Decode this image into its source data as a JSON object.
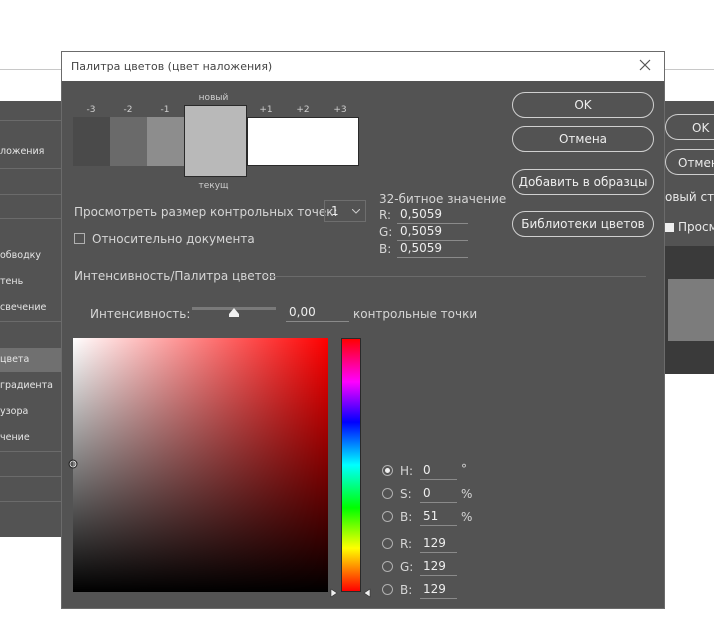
{
  "background_left_items": [
    "ложения",
    "обводку",
    "тень",
    "свечение",
    "цвета",
    "градиента",
    "узора",
    "чение"
  ],
  "background_right": {
    "ok": "OK",
    "cancel": "Отмен",
    "style": "овый сти",
    "preview": "Просм"
  },
  "dialog": {
    "title": "Палитра цветов (цвет наложения)",
    "swatch_labels": {
      "new": "новый",
      "current": "текущ"
    },
    "ticks": [
      "-3",
      "-2",
      "-1",
      "+1",
      "+2",
      "+3"
    ],
    "buttons": {
      "ok": "OK",
      "cancel": "Отмена",
      "add_swatches": "Добавить в образцы",
      "libraries": "Библиотеки цветов"
    },
    "sample": {
      "label": "Просмотреть размер контрольных точек:",
      "value": "1"
    },
    "relative_doc": {
      "label": "Относительно документа",
      "checked": false
    },
    "bit32": {
      "title": "32-битное значение",
      "r_label": "R:",
      "r": "0,5059",
      "g_label": "G:",
      "g": "0,5059",
      "b_label": "B:",
      "b": "0,5059"
    },
    "section_title": "Интенсивность/Палитра цветов",
    "intensity": {
      "label": "Интенсивность:",
      "value": "0,00",
      "unit": "контрольные точки",
      "slider_fraction": 0.5
    },
    "hsb": {
      "h_label": "H:",
      "h": "0",
      "h_unit": "°",
      "s_label": "S:",
      "s": "0",
      "s_unit": "%",
      "b_label": "B:",
      "b": "51",
      "b_unit": "%"
    },
    "rgb": {
      "r_label": "R:",
      "r": "129",
      "g_label": "G:",
      "g": "129",
      "b_label": "B:",
      "b": "129"
    },
    "selected_mode": "H",
    "colors": {
      "hue": "#ff0000",
      "current": "#818181",
      "swatch_m3": "#4a4a4a",
      "swatch_m2": "#6a6a6a",
      "swatch_m1": "#8d8d8d",
      "swatch_new": "#b9b9b9",
      "swatch_plus": "#ffffff"
    }
  }
}
